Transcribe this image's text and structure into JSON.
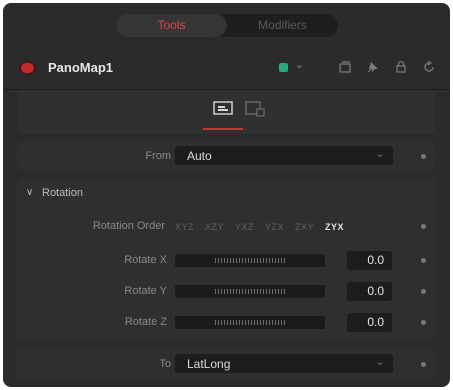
{
  "tabs": {
    "tools": "Tools",
    "modifiers": "Modifiers"
  },
  "node": {
    "name": "PanoMap1"
  },
  "colors": {
    "accent": "#e0464a",
    "node_chip": "#2aa87a",
    "node_dot": "#c42a2a"
  },
  "icons": {
    "header": [
      "version-icon",
      "pin-icon",
      "lock-icon",
      "reset-icon"
    ],
    "view": [
      "controls-icon",
      "settings-icon"
    ]
  },
  "from": {
    "label": "From",
    "value": "Auto"
  },
  "rotation": {
    "title": "Rotation",
    "order_label": "Rotation Order",
    "order_options": [
      "XYZ",
      "XZY",
      "YXZ",
      "YZX",
      "ZXY",
      "ZYX"
    ],
    "order_selected": "ZYX",
    "rotate_x": {
      "label": "Rotate X",
      "value": "0.0"
    },
    "rotate_y": {
      "label": "Rotate Y",
      "value": "0.0"
    },
    "rotate_z": {
      "label": "Rotate Z",
      "value": "0.0"
    }
  },
  "to": {
    "label": "To",
    "value": "LatLong"
  }
}
